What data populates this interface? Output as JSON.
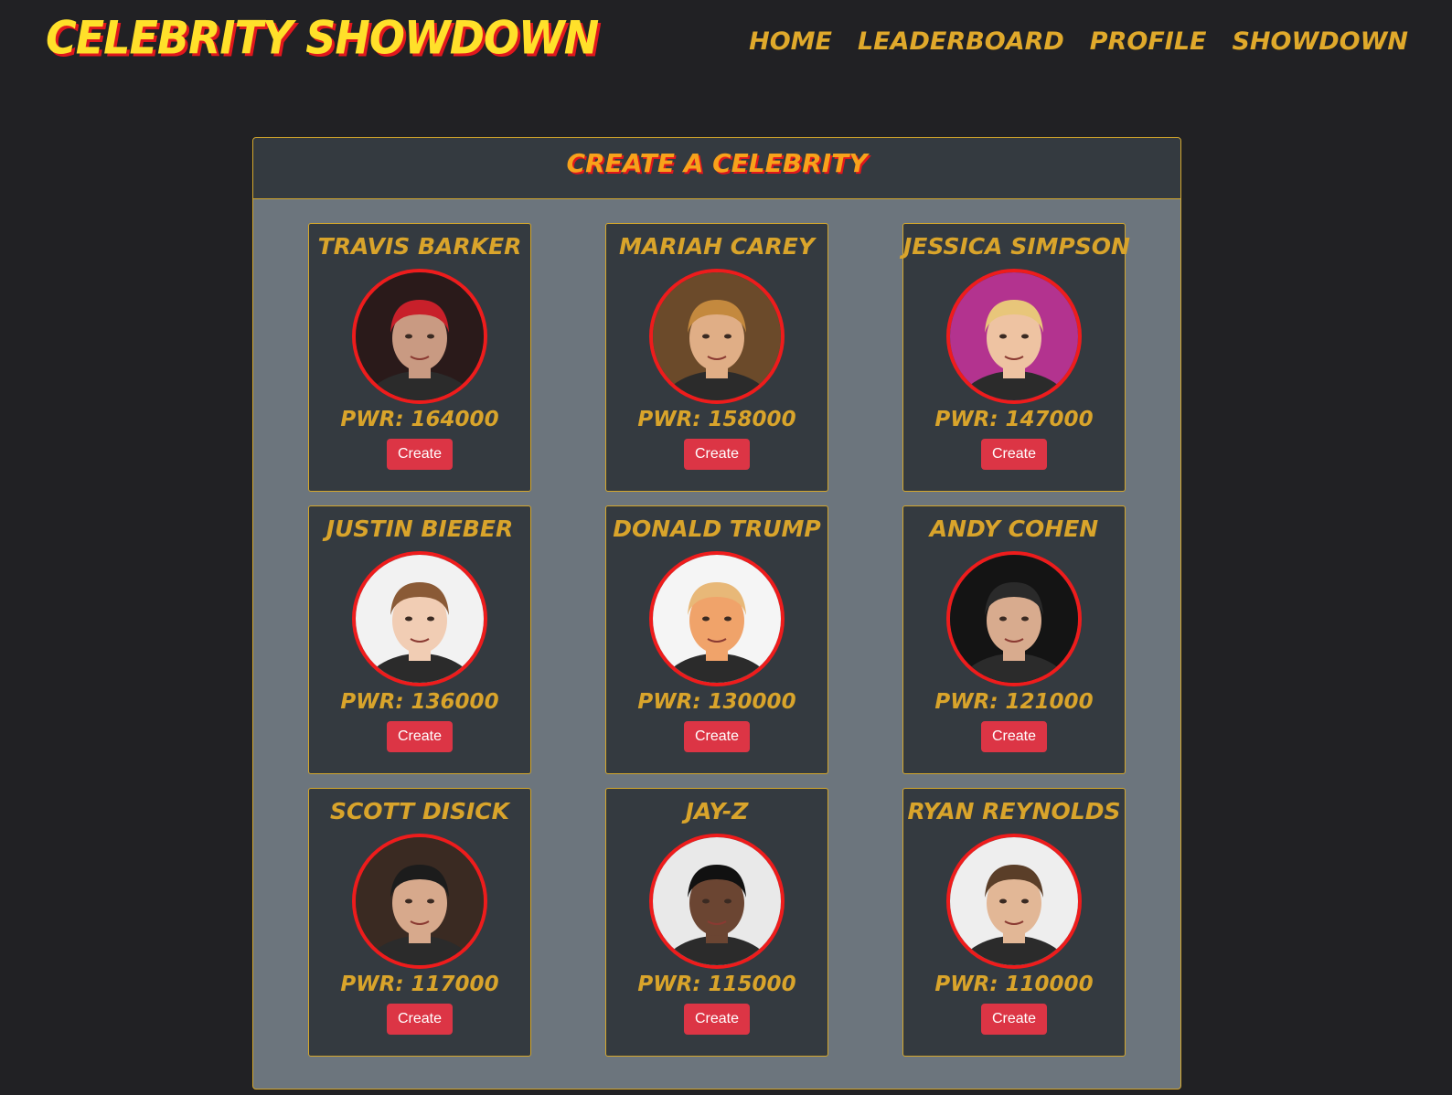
{
  "app": {
    "brand": "Celebrity Showdown"
  },
  "nav": {
    "items": [
      {
        "label": "Home"
      },
      {
        "label": "Leaderboard"
      },
      {
        "label": "Profile"
      },
      {
        "label": "Showdown"
      }
    ]
  },
  "panel": {
    "title": "Create a Celebrity"
  },
  "colors": {
    "background": "#212124",
    "panel_bg": "#6c757d",
    "card_bg": "#343a40",
    "accent_gold": "#d9a42b",
    "brand_yellow": "#ffe02a",
    "brand_red": "#e0171d",
    "button_red": "#dc3545",
    "avatar_border": "#ee1c1c"
  },
  "celebrities": [
    {
      "name": "Travis Barker",
      "pwr": "PWR: 164000",
      "button": "Create",
      "avatar": "photo-travis-barker",
      "bg": "#2a1a1a",
      "skin": "#c99a82",
      "hair": "#c8202a"
    },
    {
      "name": "Mariah Carey",
      "pwr": "PWR: 158000",
      "button": "Create",
      "avatar": "photo-mariah-carey",
      "bg": "#6b4a2a",
      "skin": "#e0ae86",
      "hair": "#c4893e"
    },
    {
      "name": "Jessica Simpson",
      "pwr": "PWR: 147000",
      "button": "Create",
      "avatar": "photo-jessica-simpson",
      "bg": "#b3338f",
      "skin": "#eec3a2",
      "hair": "#e8c67a"
    },
    {
      "name": "Justin Bieber",
      "pwr": "PWR: 136000",
      "button": "Create",
      "avatar": "photo-justin-bieber",
      "bg": "#f2f2f2",
      "skin": "#f1cdb4",
      "hair": "#8a5a36"
    },
    {
      "name": "Donald Trump",
      "pwr": "PWR: 130000",
      "button": "Create",
      "avatar": "photo-donald-trump",
      "bg": "#f5f5f5",
      "skin": "#f0a36a",
      "hair": "#e8b878"
    },
    {
      "name": "Andy Cohen",
      "pwr": "PWR: 121000",
      "button": "Create",
      "avatar": "photo-andy-cohen",
      "bg": "#141414",
      "skin": "#d8ab8e",
      "hair": "#2a2a2a"
    },
    {
      "name": "Scott Disick",
      "pwr": "PWR: 117000",
      "button": "Create",
      "avatar": "photo-scott-disick",
      "bg": "#3a2a22",
      "skin": "#d7a98c",
      "hair": "#1c1c1c"
    },
    {
      "name": "Jay-Z",
      "pwr": "PWR: 115000",
      "button": "Create",
      "avatar": "photo-jay-z",
      "bg": "#e9e9e9",
      "skin": "#6b4532",
      "hair": "#111111"
    },
    {
      "name": "Ryan Reynolds",
      "pwr": "PWR: 110000",
      "button": "Create",
      "avatar": "photo-ryan-reynolds",
      "bg": "#eeeeee",
      "skin": "#e2b796",
      "hair": "#5a3e28"
    }
  ]
}
